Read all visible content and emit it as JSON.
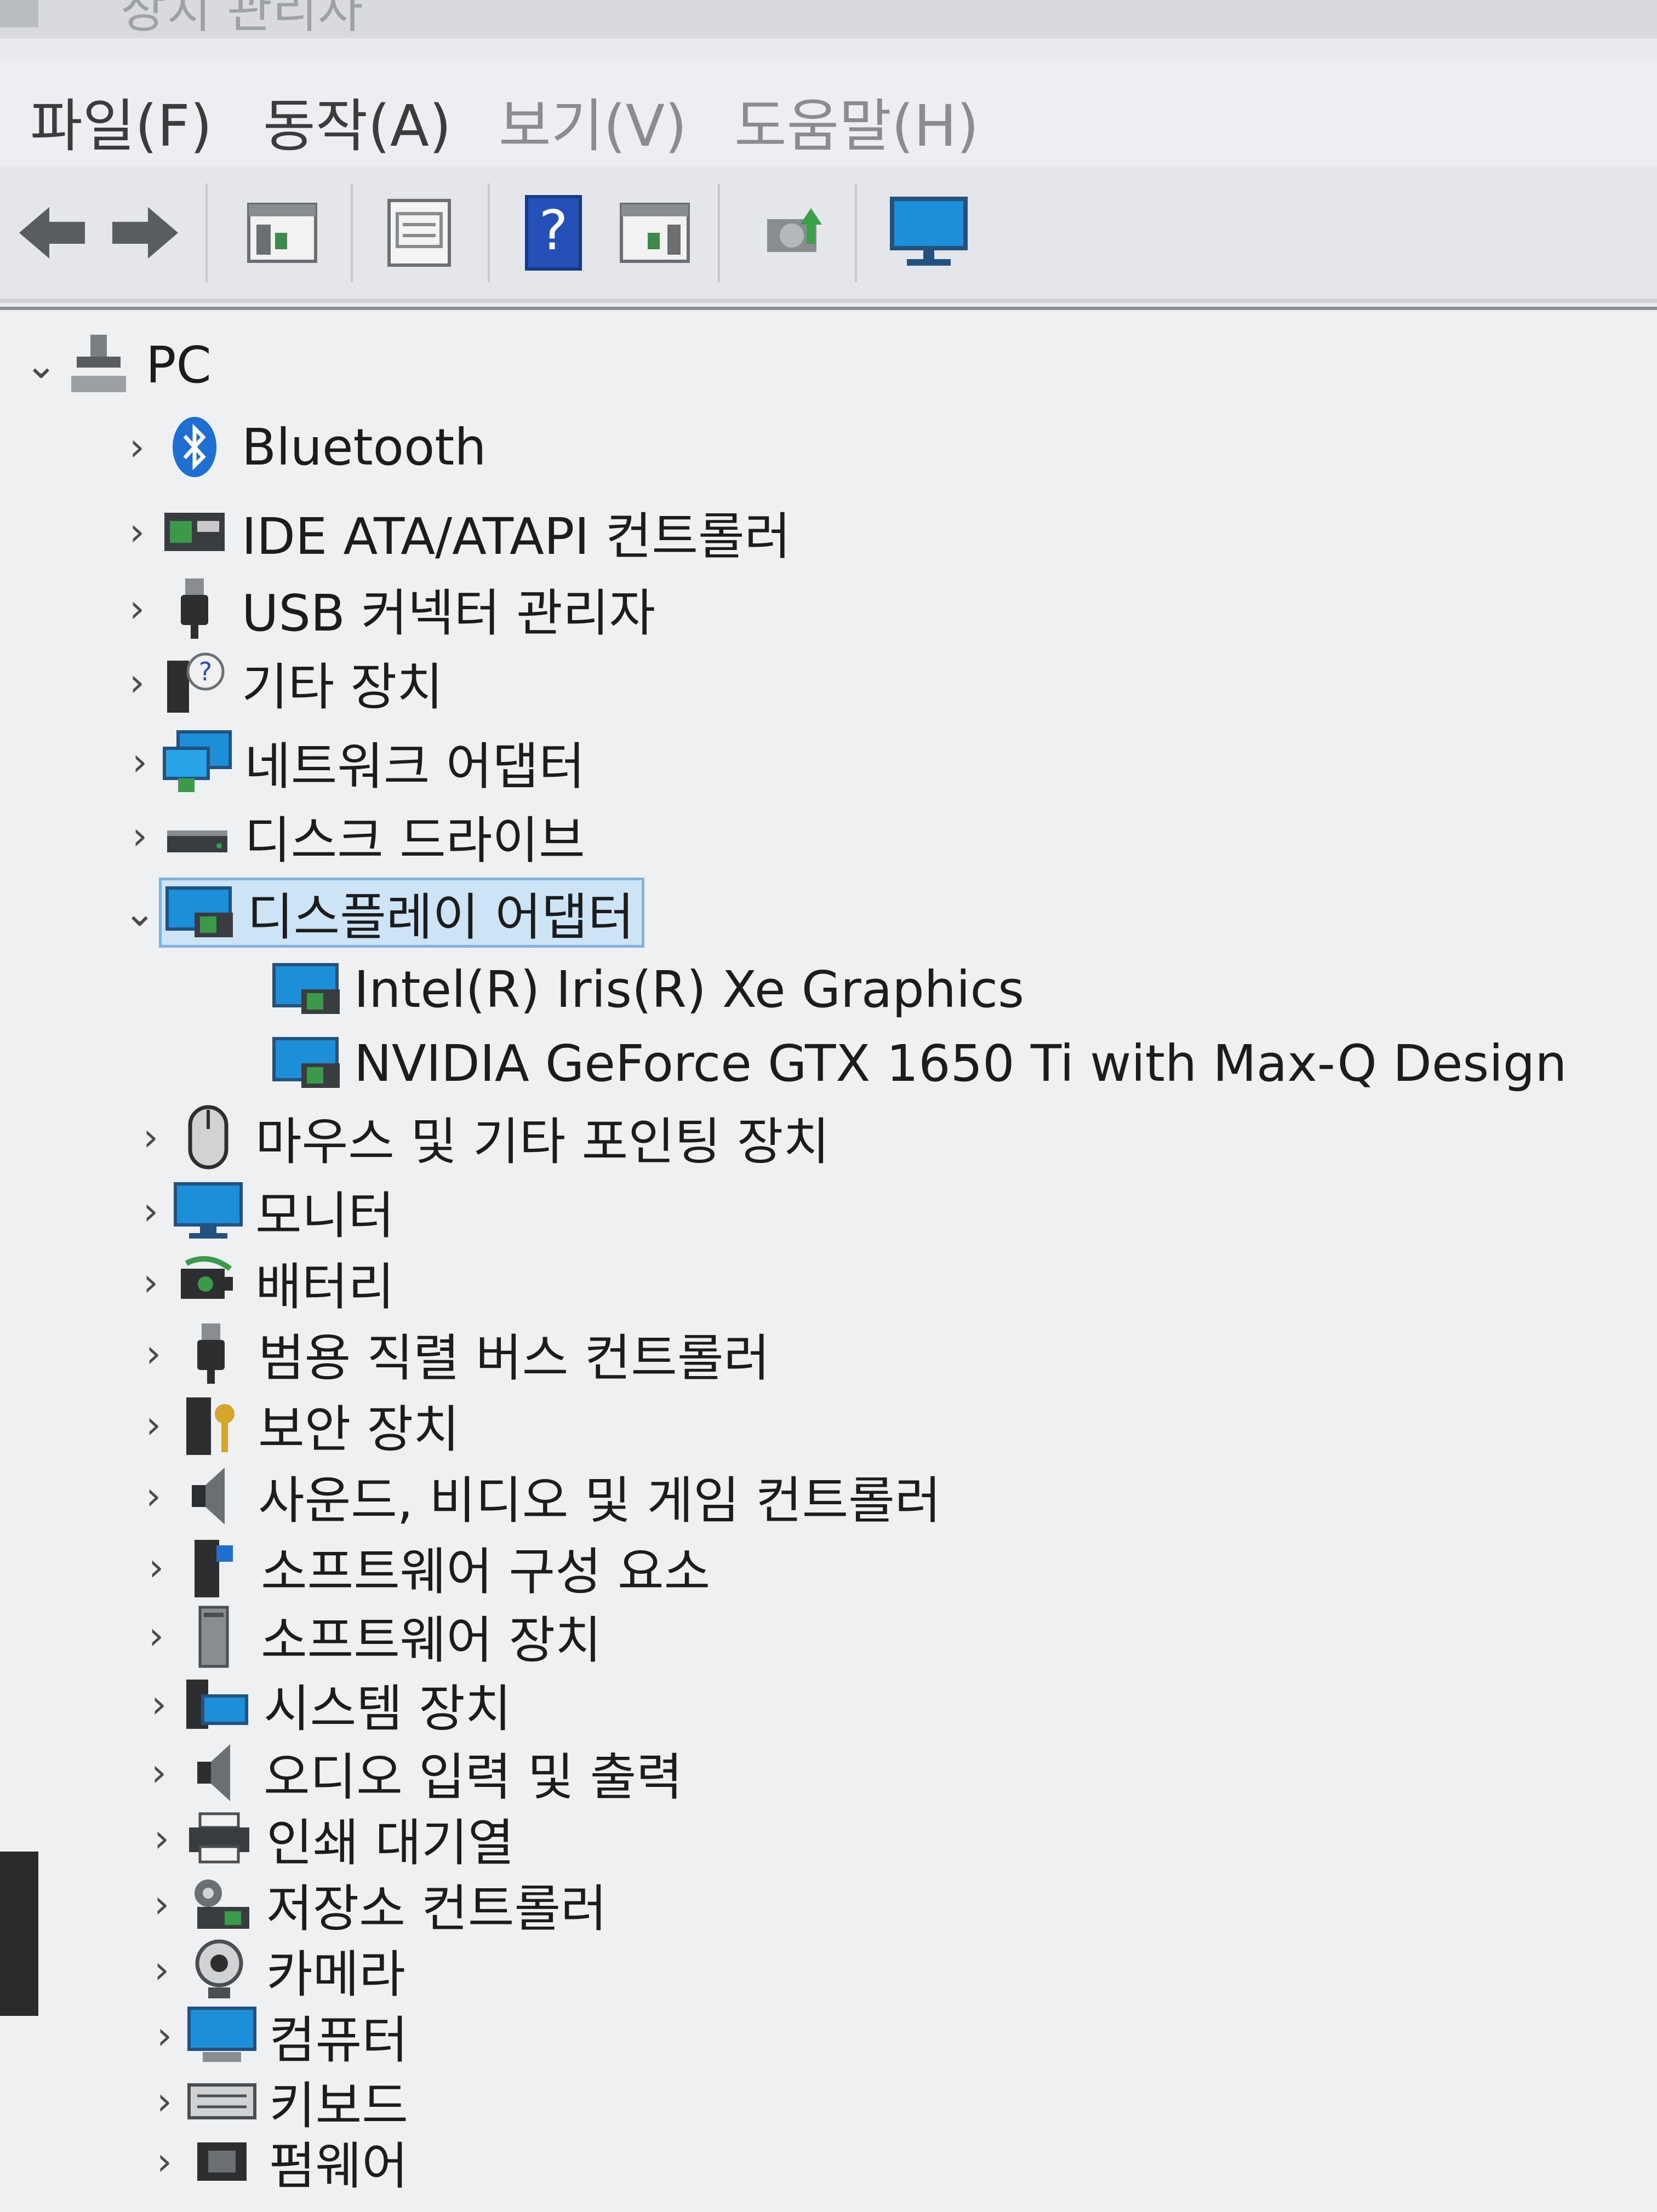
{
  "window": {
    "title": "장치 관리자"
  },
  "menu": {
    "file": "파일(F)",
    "action": "동작(A)",
    "view": "보기(V)",
    "help": "도움말(H)"
  },
  "toolbar": {
    "buttons": [
      "back-icon",
      "forward-icon",
      "show-hide-console-tree-icon",
      "properties-icon",
      "help-icon",
      "scan-icon",
      "update-driver-icon",
      "monitor-icon"
    ]
  },
  "tree": {
    "root": {
      "label": "PC"
    },
    "items": [
      {
        "label": "Bluetooth"
      },
      {
        "label": "IDE ATA/ATAPI 컨트롤러"
      },
      {
        "label": "USB 커넥터 관리자"
      },
      {
        "label": "기타 장치"
      },
      {
        "label": "네트워크 어댑터"
      },
      {
        "label": "디스크 드라이브"
      },
      {
        "label": "디스플레이 어댑터"
      },
      {
        "label": "Intel(R) Iris(R) Xe Graphics"
      },
      {
        "label": "NVIDIA GeForce GTX 1650 Ti with Max-Q Design"
      },
      {
        "label": "마우스 및 기타 포인팅 장치"
      },
      {
        "label": "모니터"
      },
      {
        "label": "배터리"
      },
      {
        "label": "범용 직렬 버스 컨트롤러"
      },
      {
        "label": "보안 장치"
      },
      {
        "label": "사운드, 비디오 및 게임 컨트롤러"
      },
      {
        "label": "소프트웨어 구성 요소"
      },
      {
        "label": "소프트웨어 장치"
      },
      {
        "label": "시스템 장치"
      },
      {
        "label": "오디오 입력 및 출력"
      },
      {
        "label": "인쇄 대기열"
      },
      {
        "label": "저장소 컨트롤러"
      },
      {
        "label": "카메라"
      },
      {
        "label": "컴퓨터"
      },
      {
        "label": "키보드"
      },
      {
        "label": "펌웨어"
      }
    ]
  },
  "colors": {
    "selection_bg": "#cde4f7",
    "selection_border": "#7fb2e0",
    "accent_blue": "#1f5fbf"
  }
}
